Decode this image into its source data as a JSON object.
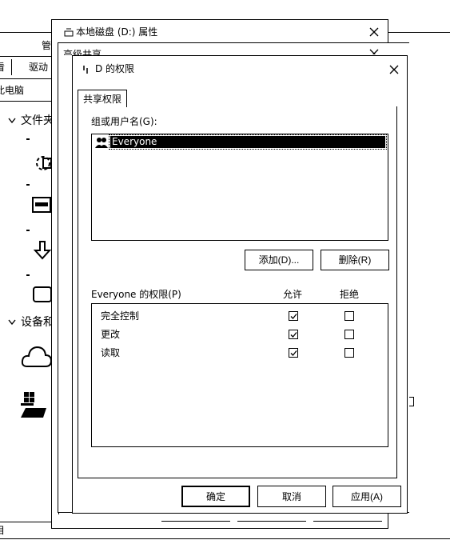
{
  "explorer": {
    "ribbon_tab_manage": "管",
    "toolbar_view": "看",
    "toolbar_drive": "驱动",
    "address": "此电脑",
    "nav_folders": "文件夹",
    "nav_devices": "设备和",
    "status_left": "目"
  },
  "properties_window": {
    "title": "本地磁盘 (D:) 属性"
  },
  "advanced_sharing_window": {
    "title": "高级共享"
  },
  "permissions_dialog": {
    "title": "D 的权限",
    "tab_share_permissions": "共享权限",
    "group_label": "组或用户名(G):",
    "users": [
      {
        "name": "Everyone",
        "icon": "users-icon",
        "selected": true
      }
    ],
    "add_button": "添加(D)...",
    "remove_button": "删除(R)",
    "permissions_label": "Everyone 的权限(P)",
    "col_allow": "允许",
    "col_deny": "拒绝",
    "permissions": [
      {
        "name": "完全控制",
        "allow": true,
        "deny": false
      },
      {
        "name": "更改",
        "allow": true,
        "deny": false
      },
      {
        "name": "读取",
        "allow": true,
        "deny": false
      }
    ],
    "ok_button": "确定",
    "cancel_button": "取消",
    "apply_button": "应用(A)"
  }
}
